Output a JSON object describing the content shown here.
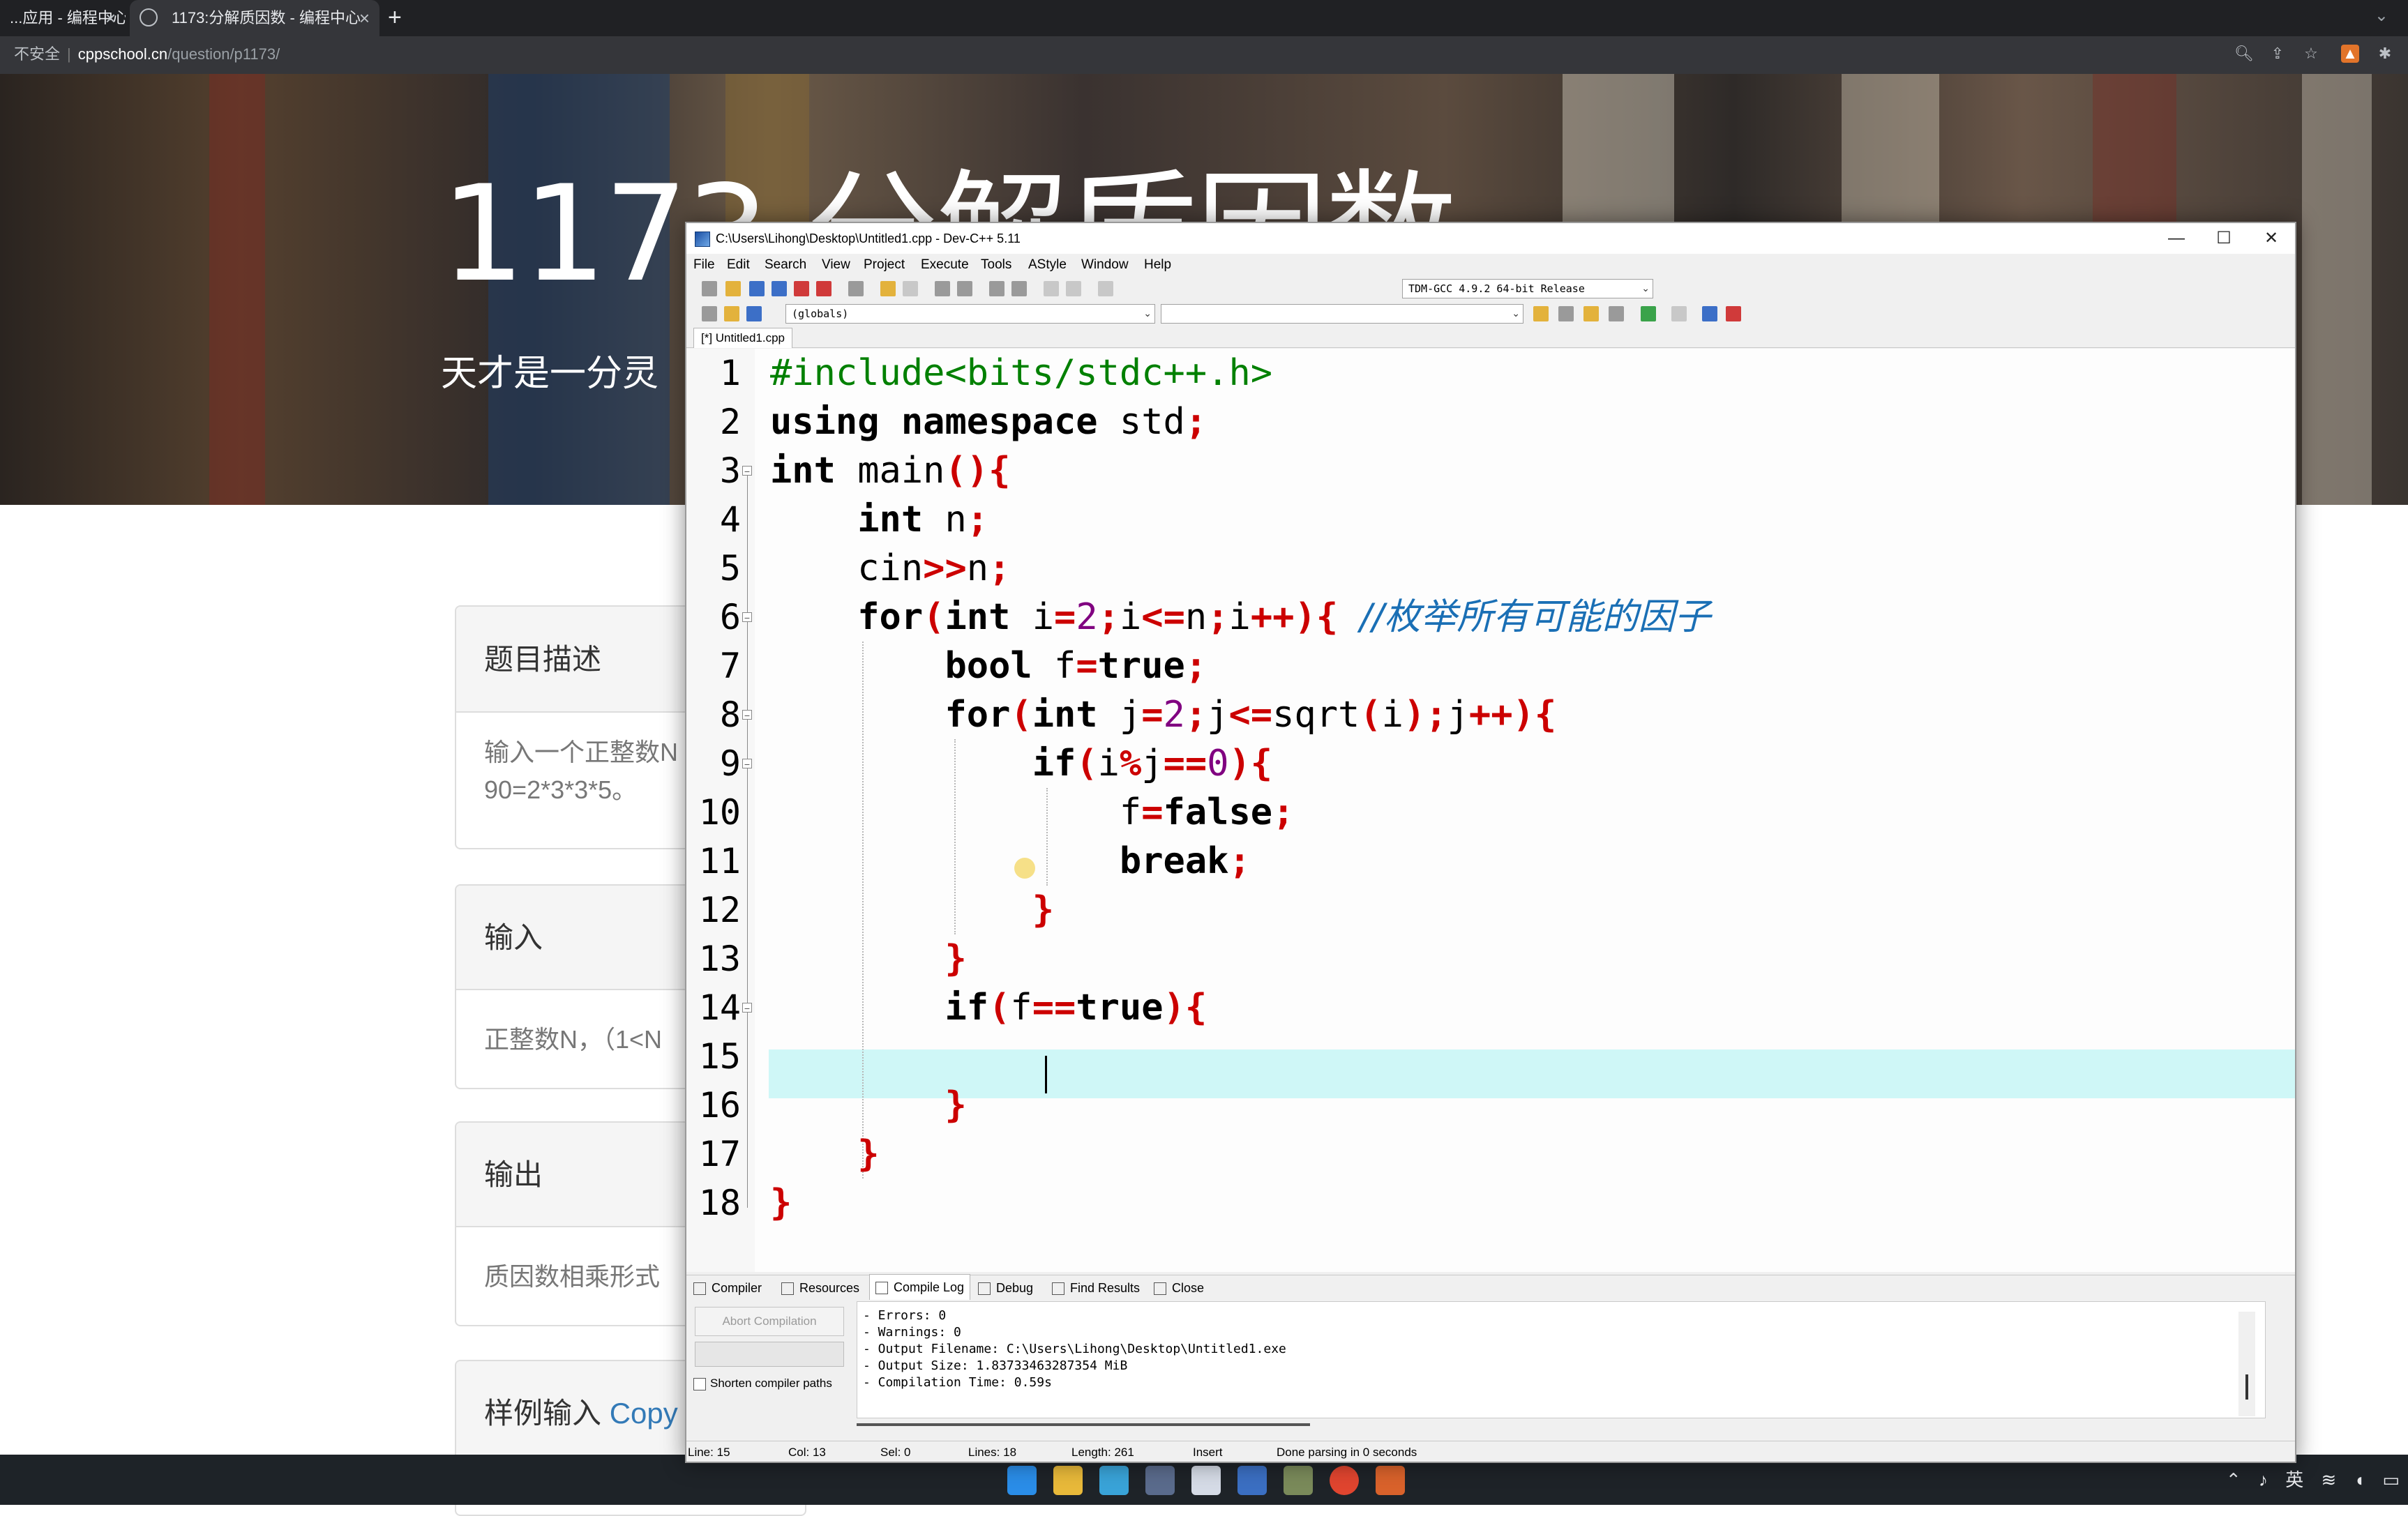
{
  "browser": {
    "tabs": [
      {
        "label": "...应用 - 编程中心"
      },
      {
        "label": "1173:分解质因数 - 编程中心"
      }
    ],
    "new_tab": "+",
    "address": {
      "insecure": "不安全",
      "host": "cppschool.cn",
      "path": "/question/p1173/"
    }
  },
  "website": {
    "title": "1173 分解质因数",
    "subtitle": "天才是一分灵",
    "sections": {
      "description": {
        "title": "题目描述",
        "body_line1": "输入一个正整数N",
        "body_line2": "90=2*3*3*5。"
      },
      "input": {
        "title": "输入",
        "body": "正整数N，（1<N"
      },
      "output": {
        "title": "输出",
        "body": "质因数相乘形式"
      },
      "sample": {
        "title": "样例输入",
        "copy": "Copy"
      }
    }
  },
  "devcpp": {
    "title": "C:\\Users\\Lihong\\Desktop\\Untitled1.cpp - Dev-C++ 5.11",
    "menu": [
      "File",
      "Edit",
      "Search",
      "View",
      "Project",
      "Execute",
      "Tools",
      "AStyle",
      "Window",
      "Help"
    ],
    "compiler_select": "TDM-GCC 4.9.2 64-bit Release",
    "scope_select": "(globals)",
    "file_tab": "[*] Untitled1.cpp",
    "line_numbers": [
      "1",
      "2",
      "3",
      "4",
      "5",
      "6",
      "7",
      "8",
      "9",
      "10",
      "11",
      "12",
      "13",
      "14",
      "15",
      "16",
      "17",
      "18"
    ],
    "code": {
      "l1": "#include<bits/stdc++.h>",
      "l2_a": "using namespace",
      "l2_b": " std",
      "l2_c": ";",
      "l3_a": "int",
      "l3_b": " main",
      "l3_c": "(){",
      "l4_a": "int",
      "l4_b": " n",
      "l4_c": ";",
      "l5_a": "cin",
      "l5_b": ">>",
      "l5_c": "n",
      "l5_d": ";",
      "l6_for": "for",
      "l6_p": "(",
      "l6_int": "int",
      "l6_i": " i",
      "l6_eq": "=",
      "l6_2": "2",
      "l6_semi": ";",
      "l6_i2": "i",
      "l6_le": "<=",
      "l6_n": "n",
      "l6_semi2": ";",
      "l6_i3": "i",
      "l6_inc": "++){",
      "l6_comment": "//枚举所有可能的因子",
      "l7_bool": "bool",
      "l7_f": " f",
      "l7_eq": "=",
      "l7_true": "true",
      "l7_semi": ";",
      "l8_for": "for",
      "l8_p": "(",
      "l8_int": "int",
      "l8_j": " j",
      "l8_eq": "=",
      "l8_2": "2",
      "l8_semi": ";",
      "l8_j2": "j",
      "l8_le": "<=",
      "l8_sqrt": "sqrt",
      "l8_p2": "(",
      "l8_i": "i",
      "l8_p3": ");",
      "l8_j3": "j",
      "l8_inc": "++){",
      "l9_if": "if",
      "l9_p": "(",
      "l9_i": "i",
      "l9_mod": "%",
      "l9_j": "j",
      "l9_eq": "==",
      "l9_0": "0",
      "l9_end": "){",
      "l10_f": "f",
      "l10_eq": "=",
      "l10_false": "false",
      "l10_semi": ";",
      "l11_break": "break",
      "l11_semi": ";",
      "l12": "}",
      "l13": "}",
      "l14_if": "if",
      "l14_p": "(",
      "l14_f": "f",
      "l14_eq": "==",
      "l14_true": "true",
      "l14_end": "){",
      "l16": "}",
      "l17": "}",
      "l18": "}"
    },
    "bottom_tabs": [
      "Compiler",
      "Resources",
      "Compile Log",
      "Debug",
      "Find Results",
      "Close"
    ],
    "abort_label": "Abort Compilation",
    "shorten_label": "Shorten compiler paths",
    "log": [
      "- Errors: 0",
      "- Warnings: 0",
      "- Output Filename: C:\\Users\\Lihong\\Desktop\\Untitled1.exe",
      "- Output Size: 1.83733463287354 MiB",
      "- Compilation Time: 0.59s"
    ],
    "status": {
      "line_label": "Line:",
      "line": "15",
      "col_label": "Col:",
      "col": "13",
      "sel_label": "Sel:",
      "sel": "0",
      "lines_label": "Lines:",
      "lines": "18",
      "length_label": "Length:",
      "length": "261",
      "mode": "Insert",
      "message": "Done parsing in 0 seconds"
    }
  },
  "taskbar": {
    "tray": {
      "ime": "英"
    }
  },
  "colors": {
    "keyword": "#000000",
    "symbol": "#cc0000",
    "preprocessor": "#008000",
    "number": "#800080",
    "comment": "#1a6fb5",
    "current_line": "#cff7f7"
  }
}
